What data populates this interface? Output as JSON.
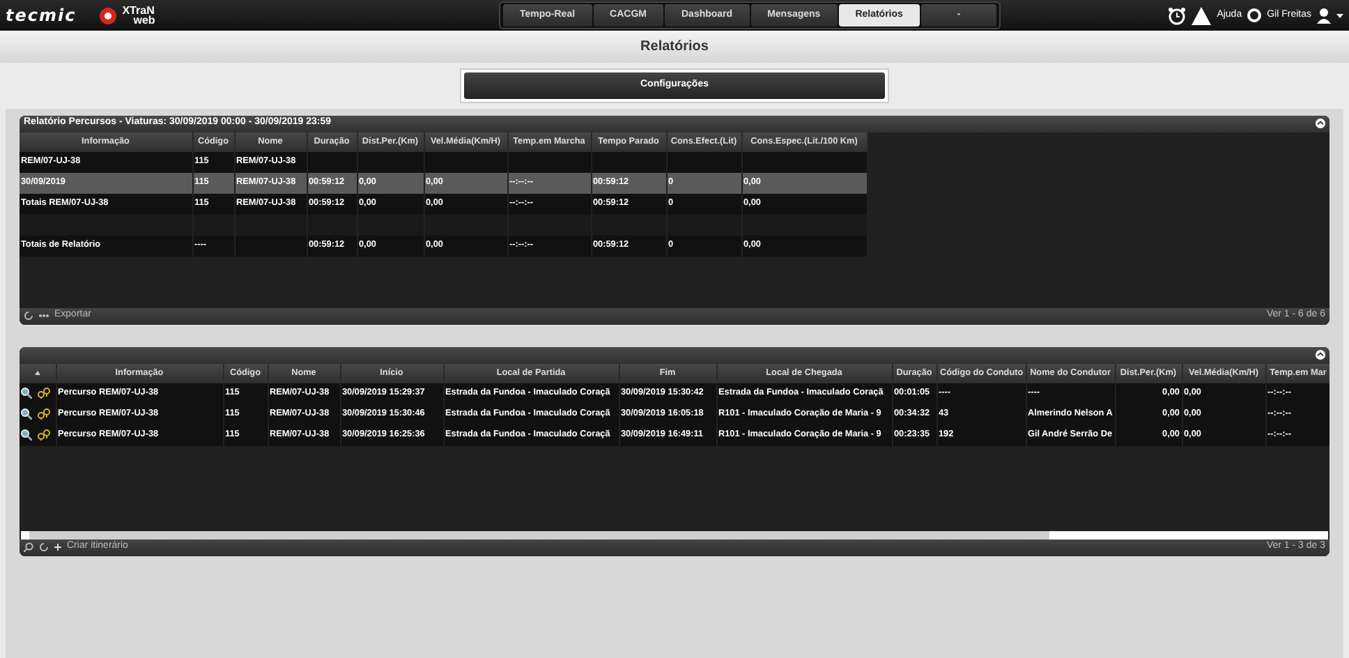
{
  "brand": {
    "logo": "tecmic",
    "product": "XTraN",
    "product_sub": "web"
  },
  "nav": [
    {
      "label": "Tempo-Real",
      "selected": false
    },
    {
      "label": "CACGM",
      "selected": false
    },
    {
      "label": "Dashboard",
      "selected": false
    },
    {
      "label": "Mensagens",
      "selected": false
    },
    {
      "label": "Relatórios",
      "selected": true
    },
    {
      "label": "-",
      "selected": false
    }
  ],
  "user_menu": {
    "help": "Ajuda",
    "user": "Gil Freitas"
  },
  "page_title": "Relatórios",
  "config_button": "Configurações",
  "summary_panel": {
    "title": "Relatório Percursos - Viaturas: 30/09/2019 00:00 - 30/09/2019 23:59",
    "columns": [
      "Informação",
      "Código",
      "Nome",
      "Duração",
      "Dist.Per.(Km)",
      "Vel.Média(Km/H)",
      "Temp.em Marcha",
      "Tempo Parado",
      "Cons.Efect.(Lit)",
      "Cons.Espec.(Lit./100 Km)"
    ],
    "rows": [
      {
        "selected": false,
        "cells": [
          "REM/07-UJ-38",
          "115",
          "REM/07-UJ-38",
          "",
          "",
          "",
          "",
          "",
          "",
          ""
        ]
      },
      {
        "selected": true,
        "cells": [
          "30/09/2019",
          "115",
          "REM/07-UJ-38",
          "00:59:12",
          "0,00",
          "0,00",
          "--:--:--",
          "00:59:12",
          "0",
          "0,00"
        ]
      },
      {
        "selected": false,
        "cells": [
          "Totais REM/07-UJ-38",
          "115",
          "REM/07-UJ-38",
          "00:59:12",
          "0,00",
          "0,00",
          "--:--:--",
          "00:59:12",
          "0",
          "0,00"
        ]
      },
      {
        "selected": false,
        "cells": [
          "",
          "",
          "",
          "",
          "",
          "",
          "",
          "",
          "",
          ""
        ]
      },
      {
        "selected": false,
        "cells": [
          "Totais de Relatório",
          "----",
          "",
          "00:59:12",
          "0,00",
          "0,00",
          "--:--:--",
          "00:59:12",
          "0",
          "0,00"
        ]
      }
    ],
    "export": "Exportar",
    "pager": "Ver 1 - 6 de 6"
  },
  "trips_panel": {
    "columns": [
      "Informação",
      "Código",
      "Nome",
      "Início",
      "Local de Partida",
      "Fim",
      "Local de Chegada",
      "Duração",
      "Código do Conduto",
      "Nome do Condutor",
      "Dist.Per.(Km)",
      "Vel.Média(Km/H)",
      "Temp.em Mar"
    ],
    "rows": [
      {
        "cells": [
          "Percurso REM/07-UJ-38",
          "115",
          "REM/07-UJ-38",
          "30/09/2019 15:29:37",
          "Estrada da Fundoa - Imaculado Coraçã",
          "30/09/2019 15:30:42",
          "Estrada da Fundoa - Imaculado Coraçã",
          "00:01:05",
          "----",
          "----",
          "0,00",
          "0,00",
          "--:--:--"
        ]
      },
      {
        "cells": [
          "Percurso REM/07-UJ-38",
          "115",
          "REM/07-UJ-38",
          "30/09/2019 15:30:46",
          "Estrada da Fundoa - Imaculado Coraçã",
          "30/09/2019 16:05:18",
          "R101 - Imaculado Coração de Maria - 9",
          "00:34:32",
          "43",
          "Almerindo Nelson A",
          "0,00",
          "0,00",
          "--:--:--"
        ]
      },
      {
        "cells": [
          "Percurso REM/07-UJ-38",
          "115",
          "REM/07-UJ-38",
          "30/09/2019 16:25:36",
          "Estrada da Fundoa - Imaculado Coraçã",
          "30/09/2019 16:49:11",
          "R101 - Imaculado Coração de Maria - 9",
          "00:23:35",
          "192",
          "Gil André Serrão De",
          "0,00",
          "0,00",
          "--:--:--"
        ]
      }
    ],
    "create": "Criar itinerário",
    "pager": "Ver 1 - 3 de 3"
  }
}
